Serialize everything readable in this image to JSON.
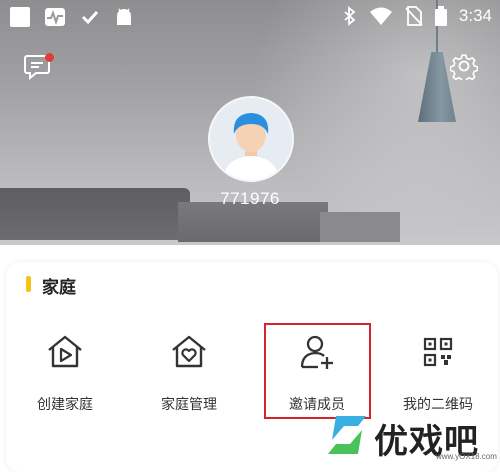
{
  "status_bar": {
    "time": "3:34",
    "left_icons": [
      "app-square-icon",
      "heart-rate-app-icon",
      "check-icon",
      "android-icon"
    ],
    "right_icons": [
      "bluetooth-icon",
      "wifi-icon",
      "no-sim-icon",
      "battery-icon"
    ]
  },
  "header": {
    "message_icon": "message-icon",
    "notification_color": "#e23b3b",
    "settings_icon": "gear-icon"
  },
  "profile": {
    "username": "771976"
  },
  "family_section": {
    "title": "家庭",
    "accent_color": "#f5c316",
    "items": [
      {
        "label": "创建家庭",
        "icon": "home-play-icon"
      },
      {
        "label": "家庭管理",
        "icon": "home-heart-icon"
      },
      {
        "label": "邀请成员",
        "icon": "add-user-icon"
      },
      {
        "label": "我的二维码",
        "icon": "qr-code-icon"
      }
    ],
    "highlight_color": "#d3242a"
  },
  "watermark": {
    "text": "优戏吧",
    "url": "www.yOX18.com"
  }
}
